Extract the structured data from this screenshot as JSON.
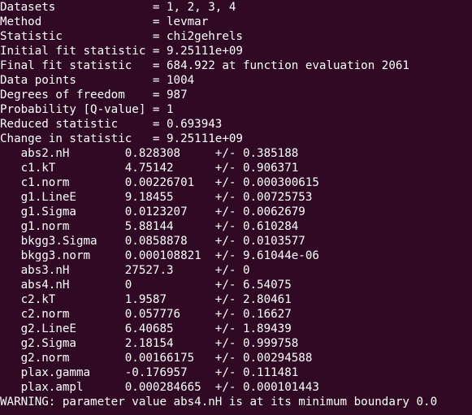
{
  "summary": [
    {
      "label": "Datasets              ",
      "sep": "= ",
      "value": "1, 2, 3, 4"
    },
    {
      "label": "Method                ",
      "sep": "= ",
      "value": "levmar"
    },
    {
      "label": "Statistic             ",
      "sep": "= ",
      "value": "chi2gehrels"
    },
    {
      "label": "Initial fit statistic ",
      "sep": "= ",
      "value": "9.25111e+09"
    },
    {
      "label": "Final fit statistic   ",
      "sep": "= ",
      "value": "684.922 at function evaluation 2061"
    },
    {
      "label": "Data points           ",
      "sep": "= ",
      "value": "1004"
    },
    {
      "label": "Degrees of freedom    ",
      "sep": "= ",
      "value": "987"
    },
    {
      "label": "Probability [Q-value] ",
      "sep": "= ",
      "value": "1"
    },
    {
      "label": "Reduced statistic     ",
      "sep": "= ",
      "value": "0.693943"
    },
    {
      "label": "Change in statistic   ",
      "sep": "= ",
      "value": "9.25111e+09"
    }
  ],
  "params": [
    {
      "name": "   abs2.nH        ",
      "value": "0.828308     ",
      "pm": "+/- ",
      "err": "0.385188"
    },
    {
      "name": "   c1.kT          ",
      "value": "4.75142      ",
      "pm": "+/- ",
      "err": "0.906371"
    },
    {
      "name": "   c1.norm        ",
      "value": "0.00226701   ",
      "pm": "+/- ",
      "err": "0.000300615"
    },
    {
      "name": "   g1.LineE       ",
      "value": "9.18455      ",
      "pm": "+/- ",
      "err": "0.00725753"
    },
    {
      "name": "   g1.Sigma       ",
      "value": "0.0123207    ",
      "pm": "+/- ",
      "err": "0.0062679"
    },
    {
      "name": "   g1.norm        ",
      "value": "5.88144      ",
      "pm": "+/- ",
      "err": "0.610284"
    },
    {
      "name": "   bkgg3.Sigma    ",
      "value": "0.0858878    ",
      "pm": "+/- ",
      "err": "0.0103577"
    },
    {
      "name": "   bkgg3.norm     ",
      "value": "0.000108821  ",
      "pm": "+/- ",
      "err": "9.61044e-06"
    },
    {
      "name": "   abs3.nH        ",
      "value": "27527.3      ",
      "pm": "+/- ",
      "err": "0"
    },
    {
      "name": "   abs4.nH        ",
      "value": "0            ",
      "pm": "+/- ",
      "err": "6.54075"
    },
    {
      "name": "   c2.kT          ",
      "value": "1.9587       ",
      "pm": "+/- ",
      "err": "2.80461"
    },
    {
      "name": "   c2.norm        ",
      "value": "0.057776     ",
      "pm": "+/- ",
      "err": "0.16627"
    },
    {
      "name": "   g2.LineE       ",
      "value": "6.40685      ",
      "pm": "+/- ",
      "err": "1.89439"
    },
    {
      "name": "   g2.Sigma       ",
      "value": "2.18154      ",
      "pm": "+/- ",
      "err": "0.999758"
    },
    {
      "name": "   g2.norm        ",
      "value": "0.00166175   ",
      "pm": "+/- ",
      "err": "0.00294588"
    },
    {
      "name": "   plax.gamma     ",
      "value": "-0.176957    ",
      "pm": "+/- ",
      "err": "0.111481"
    },
    {
      "name": "   plax.ampl      ",
      "value": "0.000284665  ",
      "pm": "+/- ",
      "err": "0.000101443"
    }
  ],
  "warning": "WARNING: parameter value abs4.nH is at its minimum boundary 0.0",
  "colors": {
    "background": "#300a24",
    "foreground": "#ffffff"
  }
}
